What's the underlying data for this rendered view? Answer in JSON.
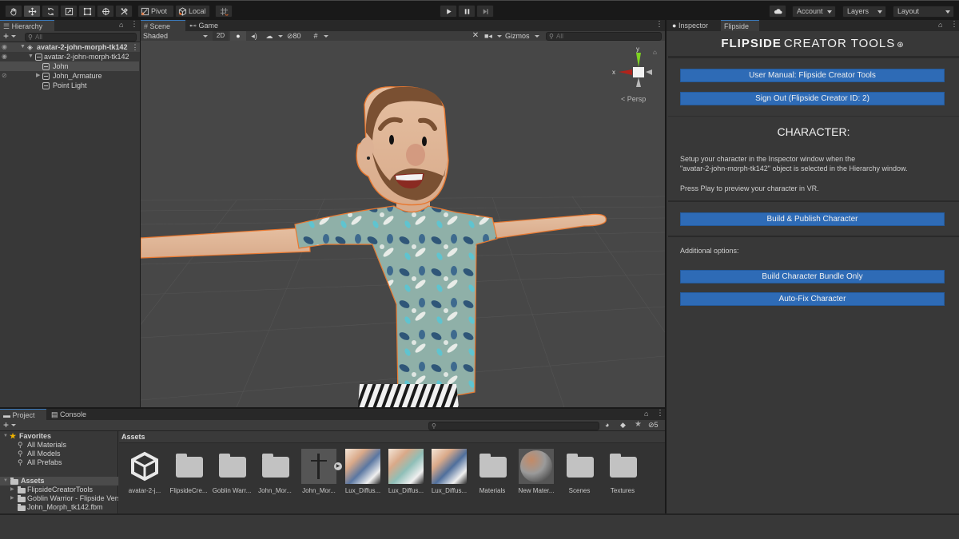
{
  "toolbar": {
    "tools": [
      "hand-tool",
      "move-tool",
      "rotate-tool",
      "scale-tool",
      "rect-tool",
      "transform-tool",
      "custom-tool"
    ],
    "active_tool": "move-tool",
    "pivot_label": "Pivot",
    "local_label": "Local",
    "account_label": "Account",
    "layers_label": "Layers",
    "layout_label": "Layout"
  },
  "hierarchy": {
    "tab_label": "Hierarchy",
    "search_placeholder": "All",
    "items": [
      {
        "label": "avatar-2-john-morph-tk142",
        "depth": 0,
        "expanded": true,
        "bold": true
      },
      {
        "label": "avatar-2-john-morph-tk142",
        "depth": 1,
        "expanded": true
      },
      {
        "label": "John",
        "depth": 2,
        "selected": true
      },
      {
        "label": "John_Armature",
        "depth": 2,
        "expanded": false
      },
      {
        "label": "Point Light",
        "depth": 2
      }
    ]
  },
  "scene": {
    "tabs": [
      {
        "label": "Scene",
        "active": true
      },
      {
        "label": "Game",
        "active": false
      }
    ],
    "shading_mode": "Shaded",
    "mode_2d_label": "2D",
    "hidden_count": "80",
    "gizmos_label": "Gizmos",
    "search_placeholder": "All",
    "axis_y": "y",
    "axis_x": "x",
    "projection_label": "< Persp"
  },
  "inspector": {
    "tabs": [
      {
        "label": "Inspector",
        "active": false
      },
      {
        "label": "Flipside",
        "active": true
      }
    ],
    "brand_bold": "FLIPSIDE",
    "brand_light": "CREATOR TOOLS",
    "buttons": {
      "user_manual": "User Manual: Flipside Creator Tools",
      "sign_out": "Sign Out (Flipside Creator ID: 2)",
      "build_publish": "Build & Publish Character",
      "build_bundle": "Build Character Bundle Only",
      "auto_fix": "Auto-Fix Character"
    },
    "section_title": "CHARACTER:",
    "setup_text_1": "Setup your character in the Inspector window when the",
    "setup_text_2": "\"avatar-2-john-morph-tk142\" object is selected in the Hierarchy window.",
    "play_text": "Press Play to preview your character in VR.",
    "additional_label": "Additional options:",
    "accent_color": "#2e6bb6"
  },
  "project": {
    "tabs": [
      {
        "label": "Project",
        "active": true
      },
      {
        "label": "Console",
        "active": false
      }
    ],
    "hidden_count": "5",
    "favorites_label": "Favorites",
    "favorites": [
      "All Materials",
      "All Models",
      "All Prefabs"
    ],
    "assets_label": "Assets",
    "asset_folders": [
      {
        "label": "FlipsideCreatorTools",
        "expandable": true
      },
      {
        "label": "Goblin Warrior - Flipside Version",
        "expandable": true
      },
      {
        "label": "John_Morph_tk142.fbm",
        "expandable": false
      }
    ],
    "breadcrumb": "Assets",
    "grid_items": [
      {
        "label": "avatar-2-j...",
        "type": "unity-prefab"
      },
      {
        "label": "FlipsideCre...",
        "type": "folder"
      },
      {
        "label": "Goblin Warr...",
        "type": "folder"
      },
      {
        "label": "John_Mor...",
        "type": "folder"
      },
      {
        "label": "John_Mor...",
        "type": "model"
      },
      {
        "label": "Lux_Diffus...",
        "type": "texture"
      },
      {
        "label": "Lux_Diffus...",
        "type": "texture"
      },
      {
        "label": "Lux_Diffus...",
        "type": "texture"
      },
      {
        "label": "Materials",
        "type": "folder"
      },
      {
        "label": "New Mater...",
        "type": "material"
      },
      {
        "label": "Scenes",
        "type": "folder"
      },
      {
        "label": "Textures",
        "type": "folder"
      }
    ]
  }
}
